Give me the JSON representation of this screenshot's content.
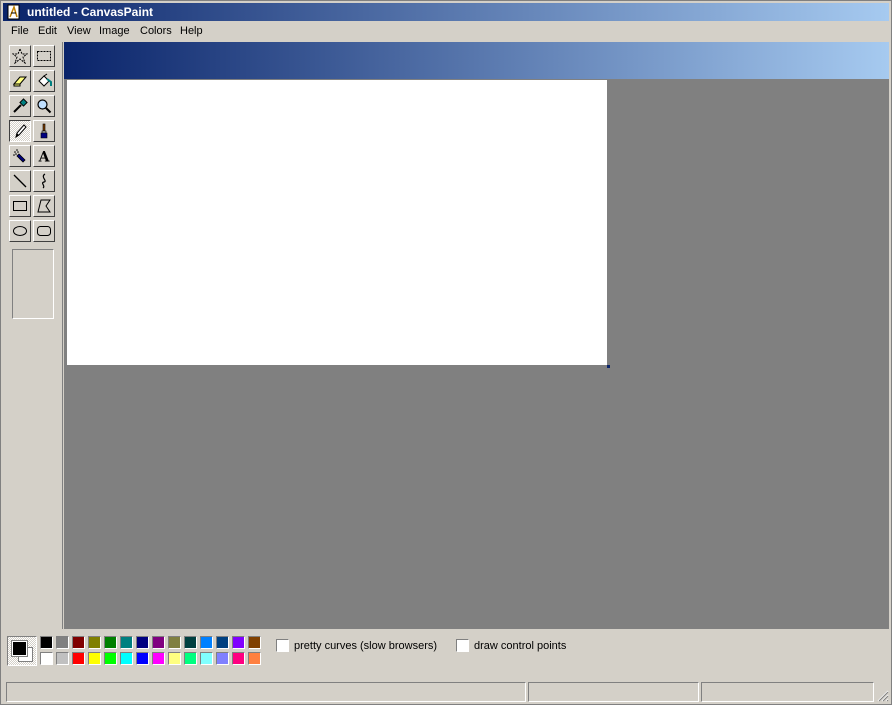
{
  "window": {
    "title": "untitled - CanvasPaint"
  },
  "menu": {
    "items": [
      "File",
      "Edit",
      "View",
      "Image",
      "Colors",
      "Help"
    ]
  },
  "tools": [
    {
      "name": "free-form-select",
      "icon": "star-select-icon"
    },
    {
      "name": "rect-select",
      "icon": "rect-select-icon"
    },
    {
      "name": "eraser",
      "icon": "eraser-icon"
    },
    {
      "name": "fill",
      "icon": "paint-bucket-icon"
    },
    {
      "name": "color-picker",
      "icon": "eyedropper-icon"
    },
    {
      "name": "magnifier",
      "icon": "magnifier-icon"
    },
    {
      "name": "pencil",
      "icon": "pencil-icon",
      "active": true
    },
    {
      "name": "brush",
      "icon": "brush-icon"
    },
    {
      "name": "airbrush",
      "icon": "airbrush-icon"
    },
    {
      "name": "text",
      "icon": "text-icon",
      "glyph": "A"
    },
    {
      "name": "line",
      "icon": "line-icon"
    },
    {
      "name": "curve",
      "icon": "curve-icon"
    },
    {
      "name": "rectangle",
      "icon": "rectangle-icon"
    },
    {
      "name": "polygon",
      "icon": "polygon-icon"
    },
    {
      "name": "ellipse",
      "icon": "ellipse-icon"
    },
    {
      "name": "rounded-rectangle",
      "icon": "rounded-rect-icon"
    }
  ],
  "colors": {
    "foreground": "#000000",
    "background": "#ffffff",
    "palette_top": [
      "#000000",
      "#808080",
      "#800000",
      "#808000",
      "#008000",
      "#008080",
      "#000080",
      "#800080",
      "#808040",
      "#004040",
      "#0080ff",
      "#004080",
      "#8000ff",
      "#804000"
    ],
    "palette_bottom": [
      "#ffffff",
      "#c0c0c0",
      "#ff0000",
      "#ffff00",
      "#00ff00",
      "#00ffff",
      "#0000ff",
      "#ff00ff",
      "#ffff80",
      "#00ff80",
      "#80ffff",
      "#8080ff",
      "#ff0080",
      "#ff8040"
    ]
  },
  "options": {
    "pretty_curves": {
      "label": "pretty curves (slow browsers)",
      "checked": false
    },
    "draw_control_points": {
      "label": "draw control points",
      "checked": false
    }
  },
  "status": {
    "message": "",
    "position": "",
    "size": ""
  }
}
